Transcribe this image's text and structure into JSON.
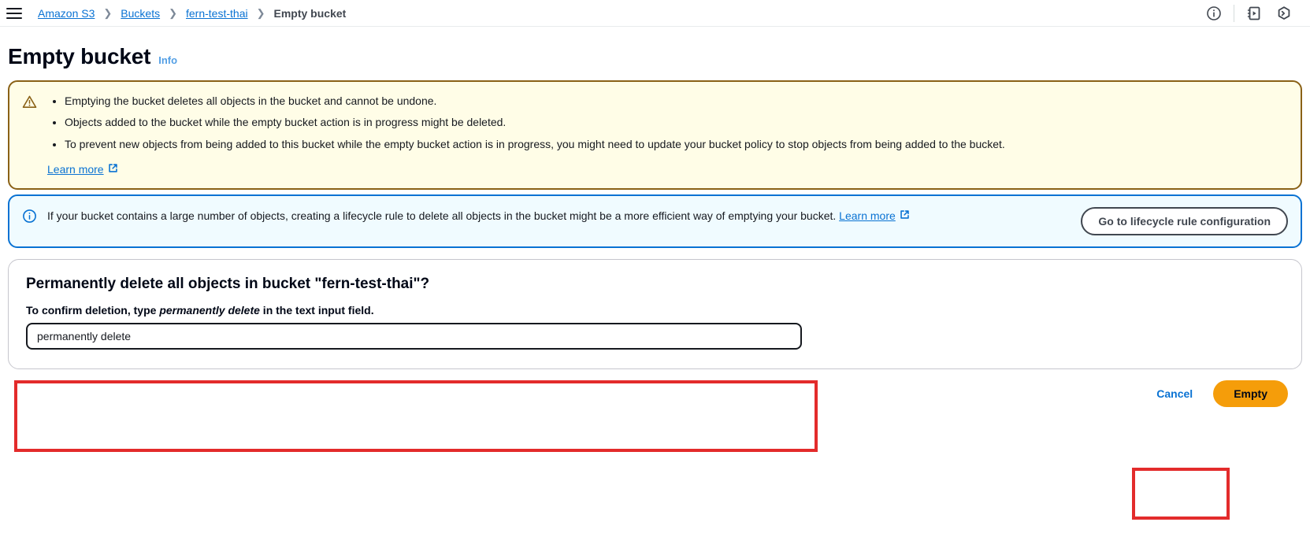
{
  "breadcrumb": {
    "items": [
      {
        "label": "Amazon S3",
        "type": "link"
      },
      {
        "label": "Buckets",
        "type": "link"
      },
      {
        "label": "fern-test-thai",
        "type": "link"
      },
      {
        "label": "Empty bucket",
        "type": "current"
      }
    ],
    "separator": "❯",
    "menu_icon": "hamburger-menu-icon"
  },
  "topbar_icons": [
    {
      "name": "info-circle-icon",
      "title": "Info"
    },
    {
      "name": "notifications-tutorial-icon",
      "title": "Tutorials"
    },
    {
      "name": "cloudshell-icon",
      "title": "CloudShell"
    }
  ],
  "header": {
    "title": "Empty bucket",
    "info_label": "Info"
  },
  "warning_alert": {
    "icon": "warning-triangle-icon",
    "bullets": [
      "Emptying the bucket deletes all objects in the bucket and cannot be undone.",
      "Objects added to the bucket while the empty bucket action is in progress might be deleted.",
      "To prevent new objects from being added to this bucket while the empty bucket action is in progress, you might need to update your bucket policy to stop objects from being added to the bucket."
    ],
    "learn_more_label": "Learn more",
    "external_icon": "external-link-icon",
    "border_color": "#8a6116",
    "background_color": "#fffde7"
  },
  "info_alert": {
    "icon": "info-circle-icon",
    "text": "If your bucket contains a large number of objects, creating a lifecycle rule to delete all objects in the bucket might be a more efficient way of emptying your bucket.",
    "learn_more_label": "Learn more",
    "external_icon": "external-link-icon",
    "button_label": "Go to lifecycle rule configuration",
    "border_color": "#0972d3",
    "background_color": "#f0fbff"
  },
  "confirm_card": {
    "title": "Permanently delete all objects in bucket \"fern-test-thai\"?",
    "label_prefix": "To confirm deletion, type ",
    "label_emphasis": "permanently delete",
    "label_suffix": " in the text input field.",
    "input_value": "permanently delete",
    "input_placeholder": ""
  },
  "footer": {
    "cancel_label": "Cancel",
    "empty_label": "Empty",
    "empty_button_color": "#f59d0a"
  },
  "annotations": [
    {
      "name": "highlight-confirm-input",
      "color": "#e32b2b"
    },
    {
      "name": "highlight-empty-button",
      "color": "#e32b2b"
    }
  ]
}
